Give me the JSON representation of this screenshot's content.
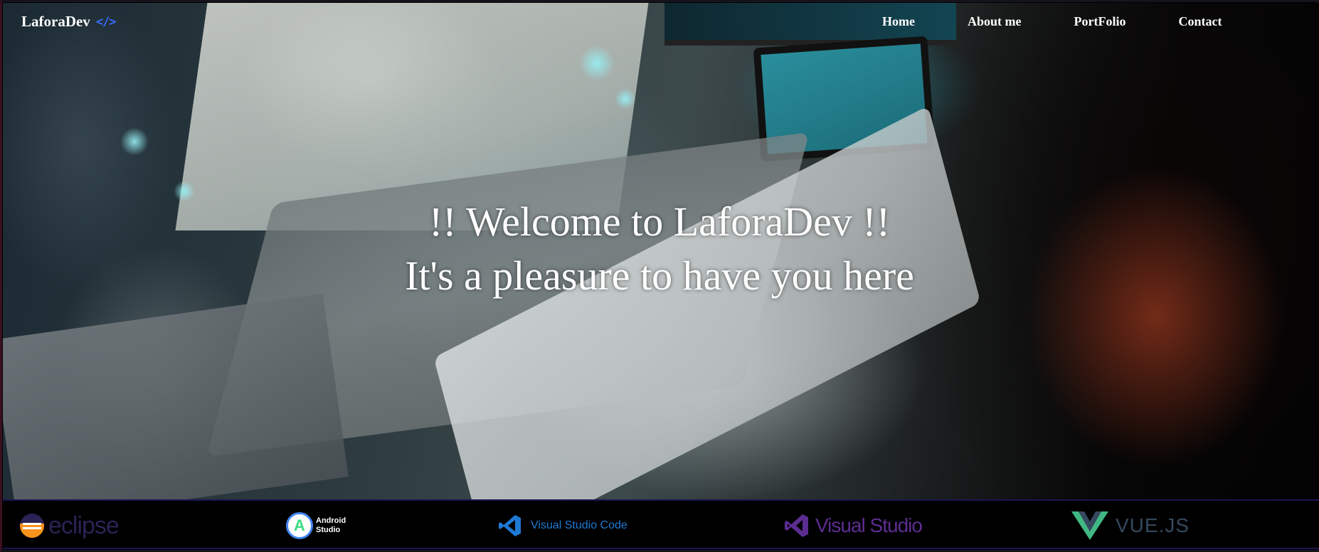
{
  "header": {
    "brand": "LaforaDev",
    "brand_icon": "</>",
    "nav": [
      {
        "label": "Home"
      },
      {
        "label": "About me"
      },
      {
        "label": "PortFolio"
      },
      {
        "label": "Contact"
      }
    ]
  },
  "hero": {
    "line1": "!! Welcome to LaforaDev !!",
    "line2": "It's a pleasure to have you here",
    "background_image": "developer-desk-photo"
  },
  "tools": [
    {
      "name": "eclipse",
      "label": "eclipse",
      "color": "#2c2255"
    },
    {
      "name": "android-studio",
      "label_line1": "Android",
      "label_line2": "Studio",
      "color": "#3ddc84"
    },
    {
      "name": "vscode",
      "label": "Visual Studio Code",
      "color": "#1f7ad4"
    },
    {
      "name": "visual-studio",
      "label": "Visual Studio",
      "color": "#5c2d91"
    },
    {
      "name": "vuejs",
      "label": "VUE.JS",
      "color": "#41b883"
    }
  ],
  "colors": {
    "accent": "#3a6cff",
    "nav_text": "#ffffff",
    "strip_border": "#1d1450"
  }
}
